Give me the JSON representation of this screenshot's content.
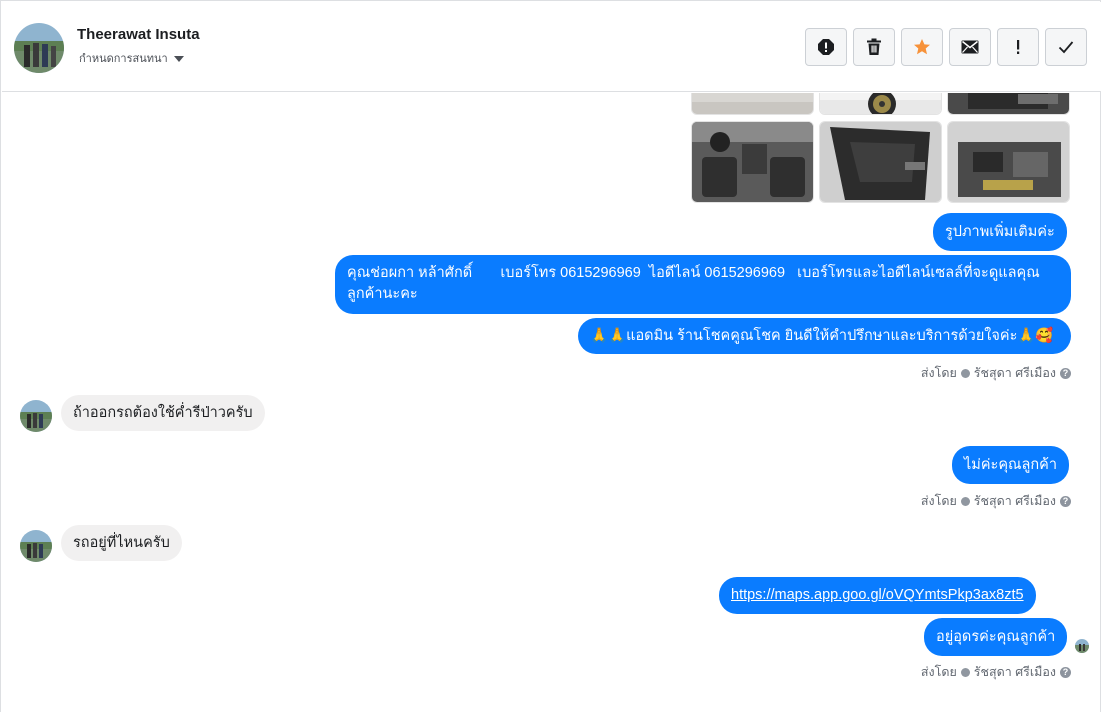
{
  "header": {
    "name": "Theerawat Insuta",
    "assign_label": "กำหนดการสนทนา"
  },
  "actions": [
    {
      "name": "report-spam-icon"
    },
    {
      "name": "trash-icon"
    },
    {
      "name": "star-icon"
    },
    {
      "name": "mail-icon"
    },
    {
      "name": "follow-up-icon"
    },
    {
      "name": "check-icon"
    }
  ],
  "colors": {
    "outgoing": "#0a7cff",
    "incoming": "#f1f0f0",
    "star": "#f7923a"
  },
  "messages": {
    "m1": "รูปภาพเพิ่มเติมค่ะ",
    "m2": "คุณช่อผกา หล้าศักดิ์       เบอร์โทร 0615296969  ไอดีไลน์ 0615296969   เบอร์โทรและไอดีไลน์เซลล์ที่จะดูแลคุณลูกค้านะคะ",
    "m3": "🙏🙏แอดมิน ร้านโชคคูณโชค ยินดีให้คำปรึกษาและบริการด้วยใจค่ะ🙏🥰",
    "m4": "ถ้าออกรถต้องใช้ค่ำรีป่าวครับ",
    "m5": "ไม่ค่ะคุณลูกค้า",
    "m6": "รถอยู่ที่ไหนครับ",
    "m7": "https://maps.app.goo.gl/oVQYmtsPkp3ax8zt5",
    "m8": "อยู่อุดรค่ะคุณลูกค้า"
  },
  "sent_by": {
    "prefix": "ส่งโดย",
    "agent": "รัชสุดา ศรีเมือง",
    "help": "?"
  }
}
